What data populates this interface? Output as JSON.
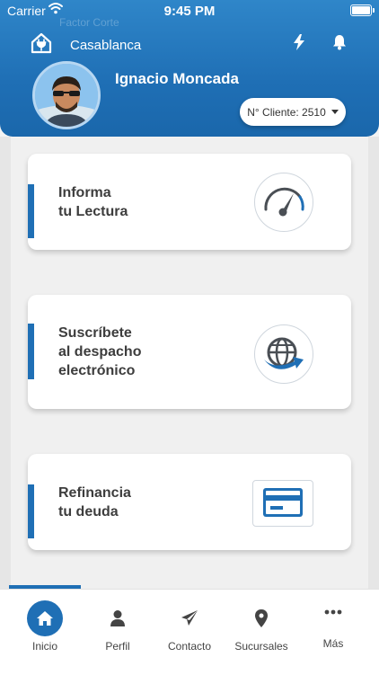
{
  "status_bar": {
    "carrier": "Carrier",
    "time": "9:45 PM"
  },
  "header": {
    "ghost_text": "Factor Corte",
    "location": "Casablanca",
    "user_name": "Ignacio Moncada",
    "client_selector": "N° Cliente: 2510"
  },
  "cards": [
    {
      "title": "Informa\ntu Lectura",
      "icon": "speedometer-icon"
    },
    {
      "title": "Suscríbete\nal despacho\nelectrónico",
      "icon": "globe-arrow-icon"
    },
    {
      "title": "Refinancia\ntu deuda",
      "icon": "credit-card-icon"
    }
  ],
  "tabs": [
    {
      "label": "Inicio",
      "icon": "home-icon",
      "active": true
    },
    {
      "label": "Perfil",
      "icon": "person-icon"
    },
    {
      "label": "Contacto",
      "icon": "paper-plane-icon"
    },
    {
      "label": "Sucursales",
      "icon": "map-pin-icon"
    },
    {
      "label": "Más",
      "icon": "more-dots-icon"
    }
  ],
  "colors": {
    "primary": "#1f6fb5",
    "header_top": "#2f86c9",
    "card_title": "#3d3d3d",
    "background": "#f0f0f0"
  }
}
